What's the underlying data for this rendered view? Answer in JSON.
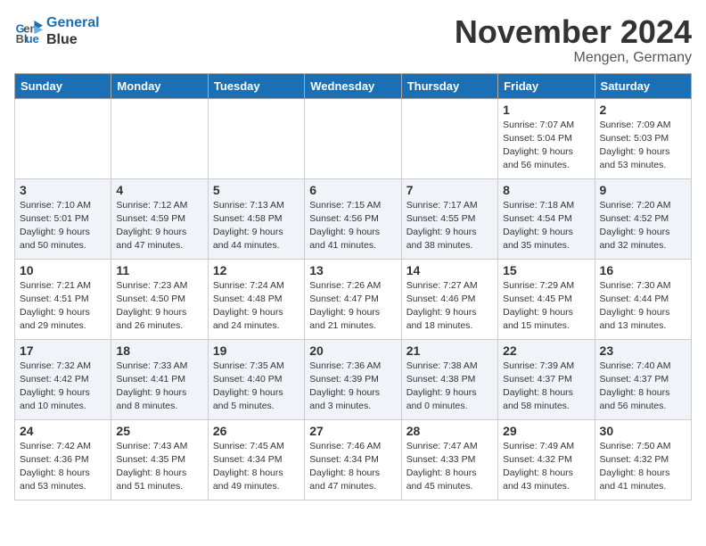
{
  "logo": {
    "line1": "General",
    "line2": "Blue"
  },
  "title": "November 2024",
  "location": "Mengen, Germany",
  "days_of_week": [
    "Sunday",
    "Monday",
    "Tuesday",
    "Wednesday",
    "Thursday",
    "Friday",
    "Saturday"
  ],
  "weeks": [
    [
      {
        "day": "",
        "info": ""
      },
      {
        "day": "",
        "info": ""
      },
      {
        "day": "",
        "info": ""
      },
      {
        "day": "",
        "info": ""
      },
      {
        "day": "",
        "info": ""
      },
      {
        "day": "1",
        "info": "Sunrise: 7:07 AM\nSunset: 5:04 PM\nDaylight: 9 hours and 56 minutes."
      },
      {
        "day": "2",
        "info": "Sunrise: 7:09 AM\nSunset: 5:03 PM\nDaylight: 9 hours and 53 minutes."
      }
    ],
    [
      {
        "day": "3",
        "info": "Sunrise: 7:10 AM\nSunset: 5:01 PM\nDaylight: 9 hours and 50 minutes."
      },
      {
        "day": "4",
        "info": "Sunrise: 7:12 AM\nSunset: 4:59 PM\nDaylight: 9 hours and 47 minutes."
      },
      {
        "day": "5",
        "info": "Sunrise: 7:13 AM\nSunset: 4:58 PM\nDaylight: 9 hours and 44 minutes."
      },
      {
        "day": "6",
        "info": "Sunrise: 7:15 AM\nSunset: 4:56 PM\nDaylight: 9 hours and 41 minutes."
      },
      {
        "day": "7",
        "info": "Sunrise: 7:17 AM\nSunset: 4:55 PM\nDaylight: 9 hours and 38 minutes."
      },
      {
        "day": "8",
        "info": "Sunrise: 7:18 AM\nSunset: 4:54 PM\nDaylight: 9 hours and 35 minutes."
      },
      {
        "day": "9",
        "info": "Sunrise: 7:20 AM\nSunset: 4:52 PM\nDaylight: 9 hours and 32 minutes."
      }
    ],
    [
      {
        "day": "10",
        "info": "Sunrise: 7:21 AM\nSunset: 4:51 PM\nDaylight: 9 hours and 29 minutes."
      },
      {
        "day": "11",
        "info": "Sunrise: 7:23 AM\nSunset: 4:50 PM\nDaylight: 9 hours and 26 minutes."
      },
      {
        "day": "12",
        "info": "Sunrise: 7:24 AM\nSunset: 4:48 PM\nDaylight: 9 hours and 24 minutes."
      },
      {
        "day": "13",
        "info": "Sunrise: 7:26 AM\nSunset: 4:47 PM\nDaylight: 9 hours and 21 minutes."
      },
      {
        "day": "14",
        "info": "Sunrise: 7:27 AM\nSunset: 4:46 PM\nDaylight: 9 hours and 18 minutes."
      },
      {
        "day": "15",
        "info": "Sunrise: 7:29 AM\nSunset: 4:45 PM\nDaylight: 9 hours and 15 minutes."
      },
      {
        "day": "16",
        "info": "Sunrise: 7:30 AM\nSunset: 4:44 PM\nDaylight: 9 hours and 13 minutes."
      }
    ],
    [
      {
        "day": "17",
        "info": "Sunrise: 7:32 AM\nSunset: 4:42 PM\nDaylight: 9 hours and 10 minutes."
      },
      {
        "day": "18",
        "info": "Sunrise: 7:33 AM\nSunset: 4:41 PM\nDaylight: 9 hours and 8 minutes."
      },
      {
        "day": "19",
        "info": "Sunrise: 7:35 AM\nSunset: 4:40 PM\nDaylight: 9 hours and 5 minutes."
      },
      {
        "day": "20",
        "info": "Sunrise: 7:36 AM\nSunset: 4:39 PM\nDaylight: 9 hours and 3 minutes."
      },
      {
        "day": "21",
        "info": "Sunrise: 7:38 AM\nSunset: 4:38 PM\nDaylight: 9 hours and 0 minutes."
      },
      {
        "day": "22",
        "info": "Sunrise: 7:39 AM\nSunset: 4:37 PM\nDaylight: 8 hours and 58 minutes."
      },
      {
        "day": "23",
        "info": "Sunrise: 7:40 AM\nSunset: 4:37 PM\nDaylight: 8 hours and 56 minutes."
      }
    ],
    [
      {
        "day": "24",
        "info": "Sunrise: 7:42 AM\nSunset: 4:36 PM\nDaylight: 8 hours and 53 minutes."
      },
      {
        "day": "25",
        "info": "Sunrise: 7:43 AM\nSunset: 4:35 PM\nDaylight: 8 hours and 51 minutes."
      },
      {
        "day": "26",
        "info": "Sunrise: 7:45 AM\nSunset: 4:34 PM\nDaylight: 8 hours and 49 minutes."
      },
      {
        "day": "27",
        "info": "Sunrise: 7:46 AM\nSunset: 4:34 PM\nDaylight: 8 hours and 47 minutes."
      },
      {
        "day": "28",
        "info": "Sunrise: 7:47 AM\nSunset: 4:33 PM\nDaylight: 8 hours and 45 minutes."
      },
      {
        "day": "29",
        "info": "Sunrise: 7:49 AM\nSunset: 4:32 PM\nDaylight: 8 hours and 43 minutes."
      },
      {
        "day": "30",
        "info": "Sunrise: 7:50 AM\nSunset: 4:32 PM\nDaylight: 8 hours and 41 minutes."
      }
    ]
  ]
}
